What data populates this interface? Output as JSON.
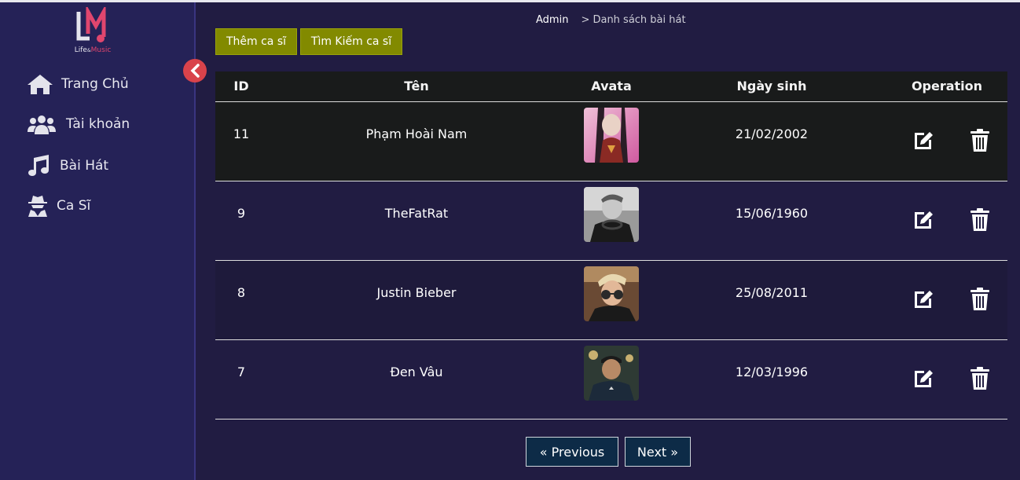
{
  "brand": {
    "logo_letters": "LM",
    "life": "Life",
    "amp": "&",
    "music": "Music"
  },
  "sidebar": {
    "items": [
      {
        "label": "Trang Chủ",
        "icon": "home-icon"
      },
      {
        "label": "Tài khoản",
        "icon": "users-icon"
      },
      {
        "label": "Bài Hát",
        "icon": "music-note-icon"
      },
      {
        "label": "Ca Sĩ",
        "icon": "user-secret-icon"
      }
    ]
  },
  "breadcrumb": {
    "root": "Admin",
    "current": "> Danh sách bài hát"
  },
  "actions": {
    "add_label": "Thêm ca sĩ",
    "search_label": "Tìm Kiếm ca sĩ"
  },
  "table": {
    "headers": [
      "ID",
      "Tên",
      "Avata",
      "Ngày sinh",
      "Operation"
    ],
    "rows": [
      {
        "id": "11",
        "name": "Phạm Hoài Nam",
        "birthday": "21/02/2002",
        "avatar": "avatar-anime-character"
      },
      {
        "id": "9",
        "name": "TheFatRat",
        "birthday": "15/06/1960",
        "avatar": "avatar-bw-man-headphones"
      },
      {
        "id": "8",
        "name": "Justin Bieber",
        "birthday": "25/08/2011",
        "avatar": "avatar-man-sunglasses"
      },
      {
        "id": "7",
        "name": "Đen Vâu",
        "birthday": "12/03/1996",
        "avatar": "avatar-man-cap"
      }
    ]
  },
  "pagination": {
    "previous": "« Previous",
    "next": "Next »"
  },
  "colors": {
    "sidebar_bg": "#252257",
    "main_bg": "#211c42",
    "action_btn": "#828a00",
    "pager_bg": "#0d2b47",
    "collapse_btn": "#d9434b"
  }
}
